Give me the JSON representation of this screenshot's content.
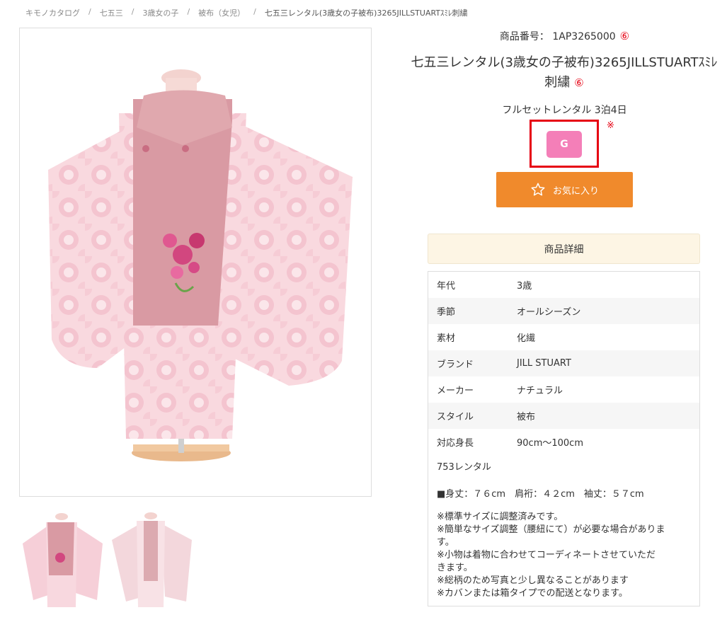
{
  "breadcrumb": {
    "items": [
      "キモノカタログ",
      "七五三",
      "3歳女の子",
      "被布（女児）"
    ],
    "current": "七五三レンタル(3歳女の子被布)3265JILLSTUARTｽﾐﾚ刺繍"
  },
  "product": {
    "code_label": "商品番号：",
    "code": "1AP3265000",
    "circle_mark": "⑥",
    "title_line1": "七五三レンタル(3歳女の子被布)3265JILLSTUARTｽﾐﾚ",
    "title_line2": "刺繍",
    "rental_type": "フルセットレンタル 3泊4日",
    "grade": "G",
    "note_mark": "※",
    "favorite_label": "お気に入り"
  },
  "details": {
    "header": "商品詳細",
    "rows": [
      {
        "label": "年代",
        "value": "3歳"
      },
      {
        "label": "季節",
        "value": "オールシーズン"
      },
      {
        "label": "素材",
        "value": "化繊"
      },
      {
        "label": "ブランド",
        "value": "JILL STUART"
      },
      {
        "label": "メーカー",
        "value": "ナチュラル"
      },
      {
        "label": "スタイル",
        "value": "被布"
      },
      {
        "label": "対応身長",
        "value": "90cm～100cm"
      }
    ],
    "model": "753レンタル",
    "size": "■身丈：７６cm　肩裄：４２cm　袖丈：５７cm",
    "cautions": [
      "※標準サイズに調整済みです。",
      "※簡単なサイズ調整（腰紐にて）が必要な場合がありま",
      "す。",
      "※小物は着物に合わせてコーディネートさせていただ",
      "きます。",
      "※総柄のため写真と少し異なることがあります",
      "※カバンまたは箱タイプでの配送となります。"
    ]
  },
  "colors": {
    "accent_orange": "#f08a2c",
    "grade_pink": "#f47fb8",
    "highlight_red": "#e60012",
    "detail_header_bg": "#fdf5e4"
  }
}
